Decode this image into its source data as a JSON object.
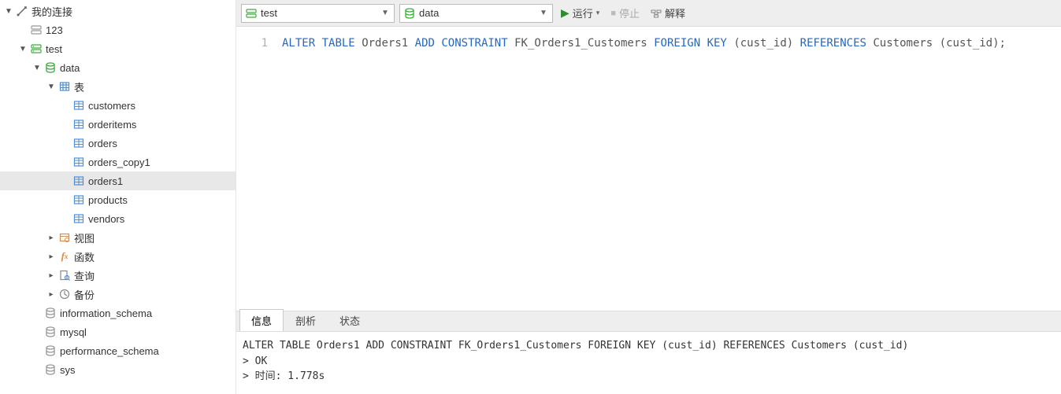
{
  "tree": {
    "root_label": "我的连接",
    "conn_123": "123",
    "conn_test": "test",
    "db_data": "data",
    "group_tables": "表",
    "tables": {
      "customers": "customers",
      "orderitems": "orderitems",
      "orders": "orders",
      "orders_copy1": "orders_copy1",
      "orders1": "orders1",
      "products": "products",
      "vendors": "vendors"
    },
    "group_views": "视图",
    "group_functions": "函数",
    "group_queries": "查询",
    "group_backups": "备份",
    "db_information_schema": "information_schema",
    "db_mysql": "mysql",
    "db_performance_schema": "performance_schema",
    "db_sys": "sys"
  },
  "toolbar": {
    "combo_connection": "test",
    "combo_database": "data",
    "run_label": "运行",
    "stop_label": "停止",
    "explain_label": "解释"
  },
  "editor": {
    "line_number": "1",
    "tokens": {
      "alter": "ALTER",
      "table": "TABLE",
      "orders1": "Orders1",
      "add": "ADD",
      "constraint": "CONSTRAINT",
      "fkname": "FK_Orders1_Customers",
      "foreign": "FOREIGN",
      "key": "KEY",
      "lp1": "(",
      "cust_id1": "cust_id",
      "rp1": ")",
      "references": "REFERENCES",
      "customers": "Customers",
      "lp2": "(",
      "cust_id2": "cust_id",
      "rp2semi": ");"
    }
  },
  "result_tabs": {
    "info": "信息",
    "profile": "剖析",
    "status": "状态"
  },
  "result": {
    "line1": "ALTER TABLE Orders1 ADD CONSTRAINT FK_Orders1_Customers FOREIGN KEY (cust_id) REFERENCES Customers (cust_id)",
    "line2": "> OK",
    "line3": "> 时间: 1.778s"
  }
}
